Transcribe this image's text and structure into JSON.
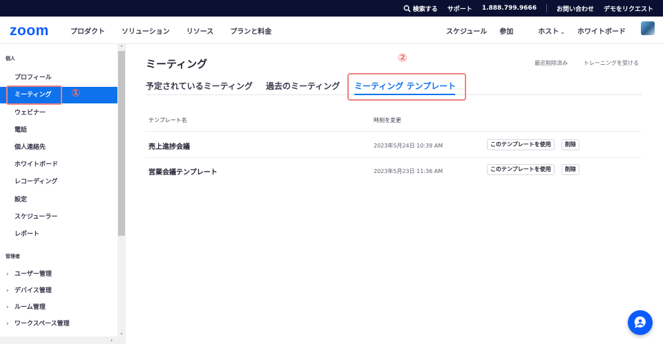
{
  "topbar": {
    "search": "検索する",
    "support": "サポート",
    "phone": "1.888.799.9666",
    "contact": "お問い合わせ",
    "demo": "デモをリクエスト"
  },
  "nav": {
    "logo": "zoom",
    "left": [
      "プロダクト",
      "ソリューション",
      "リソース",
      "プランと料金"
    ],
    "right": [
      "スケジュール",
      "参加",
      "ホスト",
      "ホワイトボード"
    ]
  },
  "sidebar": {
    "section_personal": "個人",
    "personal_items": [
      "プロフィール",
      "ミーティング",
      "ウェビナー",
      "電話",
      "個人連絡先",
      "ホワイトボード",
      "レコーディング",
      "設定",
      "スケジューラー",
      "レポート"
    ],
    "active_index": 1,
    "section_admin": "管理者",
    "admin_items": [
      "ユーザー管理",
      "デバイス管理",
      "ルーム管理",
      "ワークスペース管理"
    ]
  },
  "annotations": {
    "mark1": "①",
    "mark2": "②"
  },
  "page": {
    "title": "ミーティング",
    "recently_deleted": "最近削除済み",
    "training": "トレーニングを受ける",
    "tabs": [
      "予定されているミーティング",
      "過去のミーティング",
      "ミーティング テンプレート"
    ],
    "active_tab": 2
  },
  "table": {
    "headers": [
      "テンプレート名",
      "時刻を変更"
    ],
    "rows": [
      {
        "name": "売上進捗会議",
        "time": "2023年5月24日 10:39 AM",
        "use": "このテンプレートを使用",
        "delete": "削除"
      },
      {
        "name": "営業会議テンプレート",
        "time": "2023年5月23日 11:36 AM",
        "use": "このテンプレートを使用",
        "delete": "削除"
      }
    ]
  },
  "colors": {
    "accent": "#0e72ed",
    "topbar_bg": "#0b1033",
    "annotation": "#f08080"
  }
}
